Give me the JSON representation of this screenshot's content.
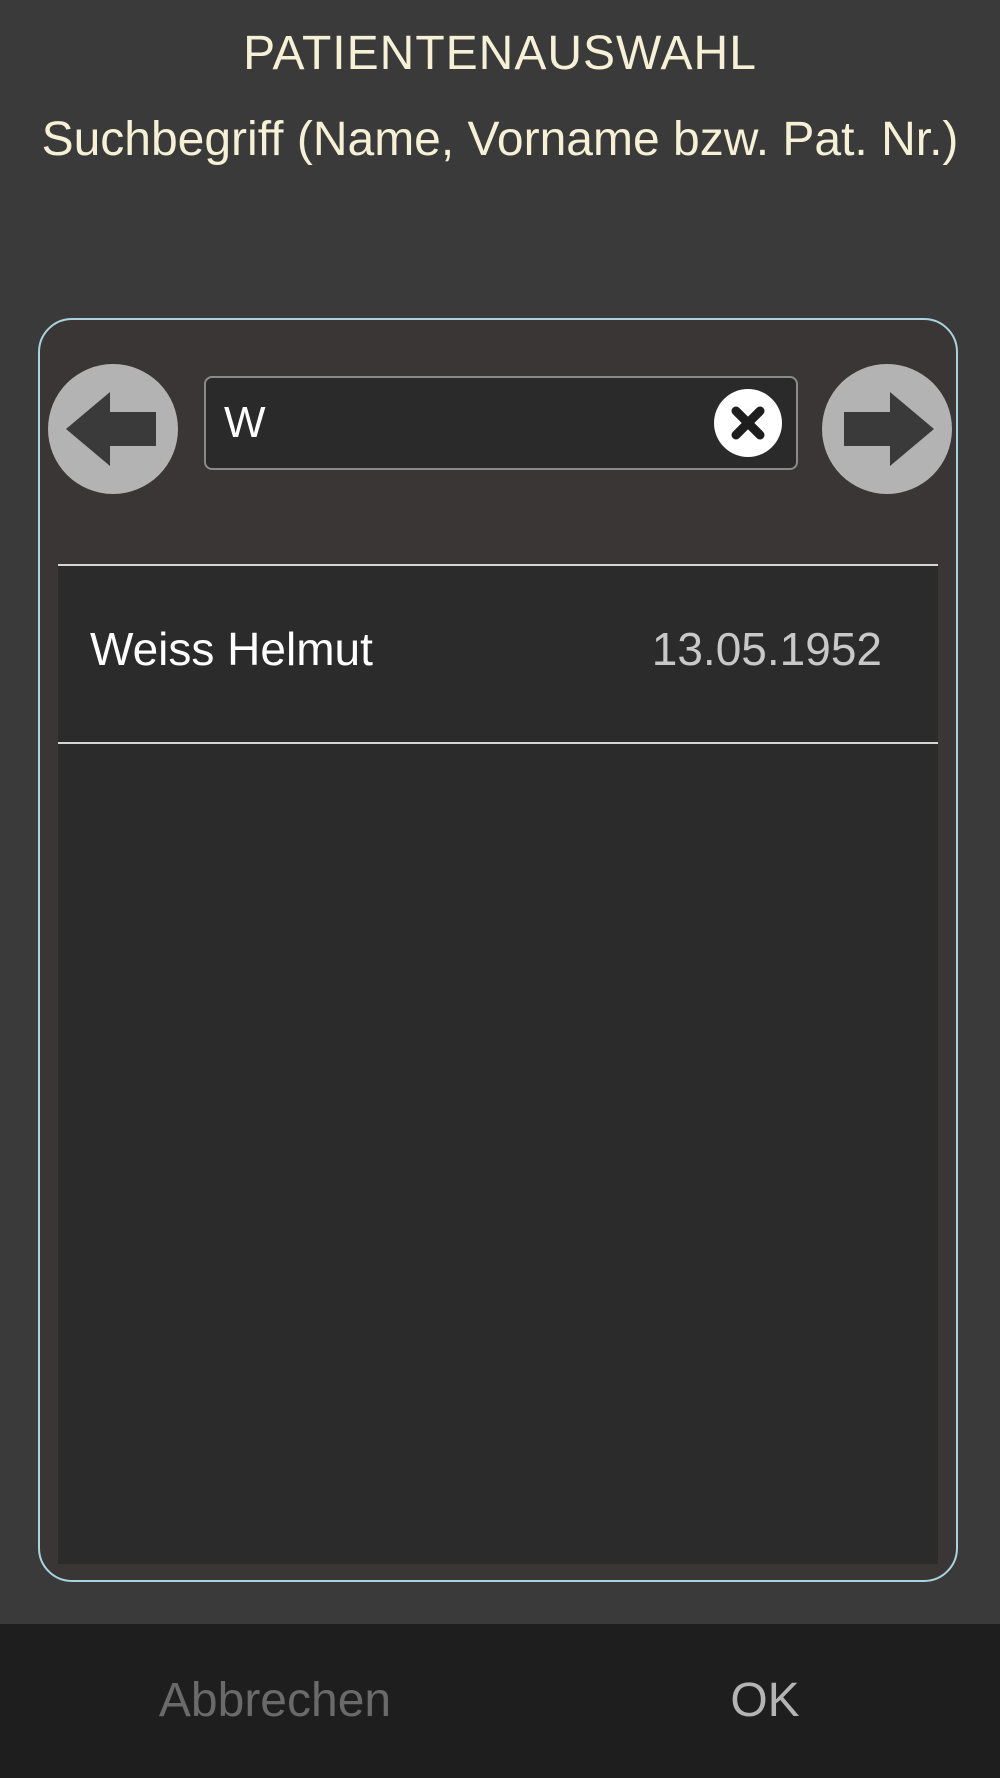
{
  "header": {
    "title": "PATIENTENAUSWAHL",
    "subtitle": "Suchbegriff (Name, Vorname bzw. Pat. Nr.)"
  },
  "search": {
    "value": "W",
    "clear_icon": "close-circle-icon",
    "prev_icon": "arrow-left-icon",
    "next_icon": "arrow-right-icon"
  },
  "results": [
    {
      "name": "Weiss Helmut",
      "birthdate": "13.05.1952"
    }
  ],
  "footer": {
    "cancel_label": "Abbrechen",
    "ok_label": "OK"
  },
  "colors": {
    "background": "#3a3a3a",
    "title_text": "#f5f0d6",
    "panel_border": "#a9d3df",
    "footer_background": "#1e1e1e"
  }
}
